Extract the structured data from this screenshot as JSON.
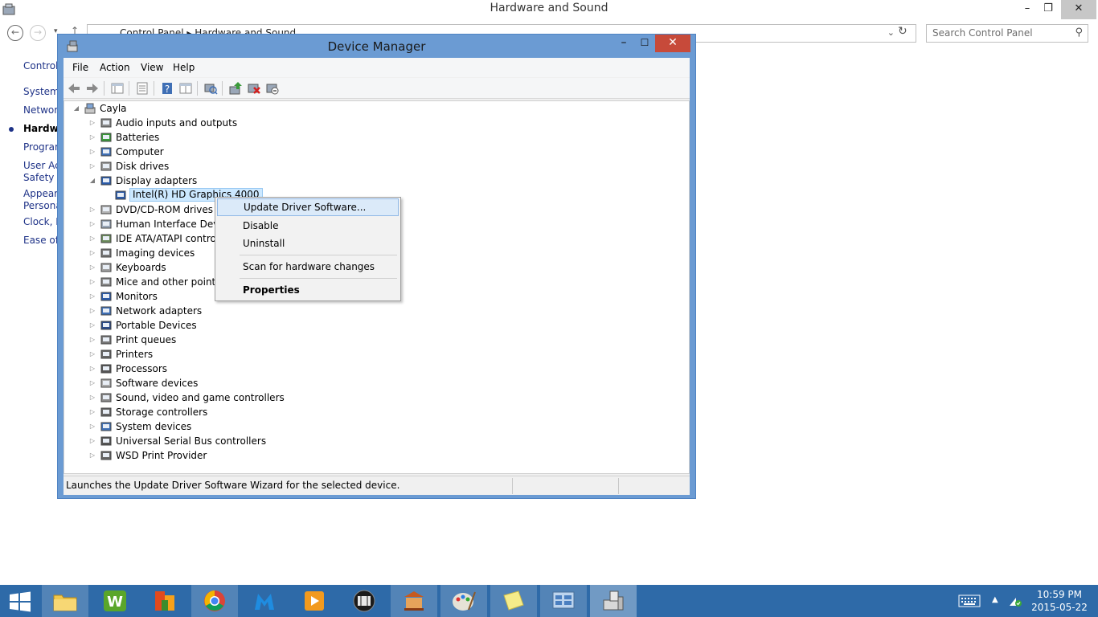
{
  "control_panel": {
    "title": "Hardware and Sound",
    "address": "Control Panel  ▸  Hardware and Sound",
    "search_placeholder": "Search Control Panel",
    "sidebar": [
      {
        "label": "Control",
        "active": false
      },
      {
        "label": "System",
        "active": false
      },
      {
        "label": "Network",
        "active": false
      },
      {
        "label": "Hardwa",
        "active": true
      },
      {
        "label": "Program",
        "active": false
      },
      {
        "label": "User Ac",
        "active": false
      },
      {
        "label": "Safety",
        "active": false
      },
      {
        "label": "Appeara",
        "active": false
      },
      {
        "label": "Persona",
        "active": false
      },
      {
        "label": "Clock, L",
        "active": false
      },
      {
        "label": "Ease of A",
        "active": false
      }
    ]
  },
  "device_manager": {
    "title": "Device Manager",
    "menu": [
      "File",
      "Action",
      "View",
      "Help"
    ],
    "toolbar": [
      "back-icon",
      "forward-icon",
      "show-hide-tree-icon",
      "properties-icon",
      "help-icon",
      "console-icon",
      "scan-hardware-icon",
      "update-driver-icon",
      "uninstall-icon",
      "disable-icon"
    ],
    "root": "Cayla",
    "categories": [
      {
        "label": "Audio inputs and outputs",
        "icon": "speaker-icon"
      },
      {
        "label": "Batteries",
        "icon": "battery-icon"
      },
      {
        "label": "Computer",
        "icon": "computer-icon"
      },
      {
        "label": "Disk drives",
        "icon": "disk-drive-icon"
      },
      {
        "label": "Display adapters",
        "icon": "display-adapter-icon",
        "expanded": true
      },
      {
        "label": "Intel(R) HD Graphics 4000",
        "icon": "display-adapter-icon",
        "child": true,
        "selected": true
      },
      {
        "label": "DVD/CD-ROM drives",
        "icon": "dvd-drive-icon"
      },
      {
        "label": "Human Interface Devic",
        "icon": "hid-icon"
      },
      {
        "label": "IDE ATA/ATAPI control",
        "icon": "ide-controller-icon"
      },
      {
        "label": "Imaging devices",
        "icon": "camera-icon"
      },
      {
        "label": "Keyboards",
        "icon": "keyboard-icon"
      },
      {
        "label": "Mice and other pointing",
        "icon": "mouse-icon"
      },
      {
        "label": "Monitors",
        "icon": "monitor-icon"
      },
      {
        "label": "Network adapters",
        "icon": "network-adapter-icon"
      },
      {
        "label": "Portable Devices",
        "icon": "portable-device-icon"
      },
      {
        "label": "Print queues",
        "icon": "print-queue-icon"
      },
      {
        "label": "Printers",
        "icon": "printer-icon"
      },
      {
        "label": "Processors",
        "icon": "processor-icon"
      },
      {
        "label": "Software devices",
        "icon": "software-device-icon"
      },
      {
        "label": "Sound, video and game controllers",
        "icon": "speaker-icon"
      },
      {
        "label": "Storage controllers",
        "icon": "storage-controller-icon"
      },
      {
        "label": "System devices",
        "icon": "system-device-icon"
      },
      {
        "label": "Universal Serial Bus controllers",
        "icon": "usb-icon"
      },
      {
        "label": "WSD Print Provider",
        "icon": "printer-icon"
      }
    ],
    "status": "Launches the Update Driver Software Wizard for the selected device."
  },
  "context_menu": {
    "items": [
      {
        "label": "Update Driver Software...",
        "highlighted": true
      },
      {
        "label": "Disable"
      },
      {
        "label": "Uninstall"
      },
      {
        "label": "Scan for hardware changes"
      },
      {
        "label": "Properties",
        "bold": true
      }
    ]
  },
  "taskbar": {
    "apps": [
      "file-explorer-icon",
      "word-processor-icon",
      "office-icon",
      "chrome-icon",
      "malwarebytes-icon",
      "media-player-icon",
      "film-icon",
      "museum-icon",
      "paint-icon",
      "sticky-notes-icon",
      "control-panel-icon",
      "device-manager-icon"
    ],
    "time": "10:59 PM",
    "date": "2015-05-22"
  },
  "colors": {
    "window_frame": "#6b9bd3",
    "close_button": "#c74a3a",
    "taskbar": "#2e6aa8",
    "selection": "#cce8ff",
    "link": "#1e3287"
  }
}
